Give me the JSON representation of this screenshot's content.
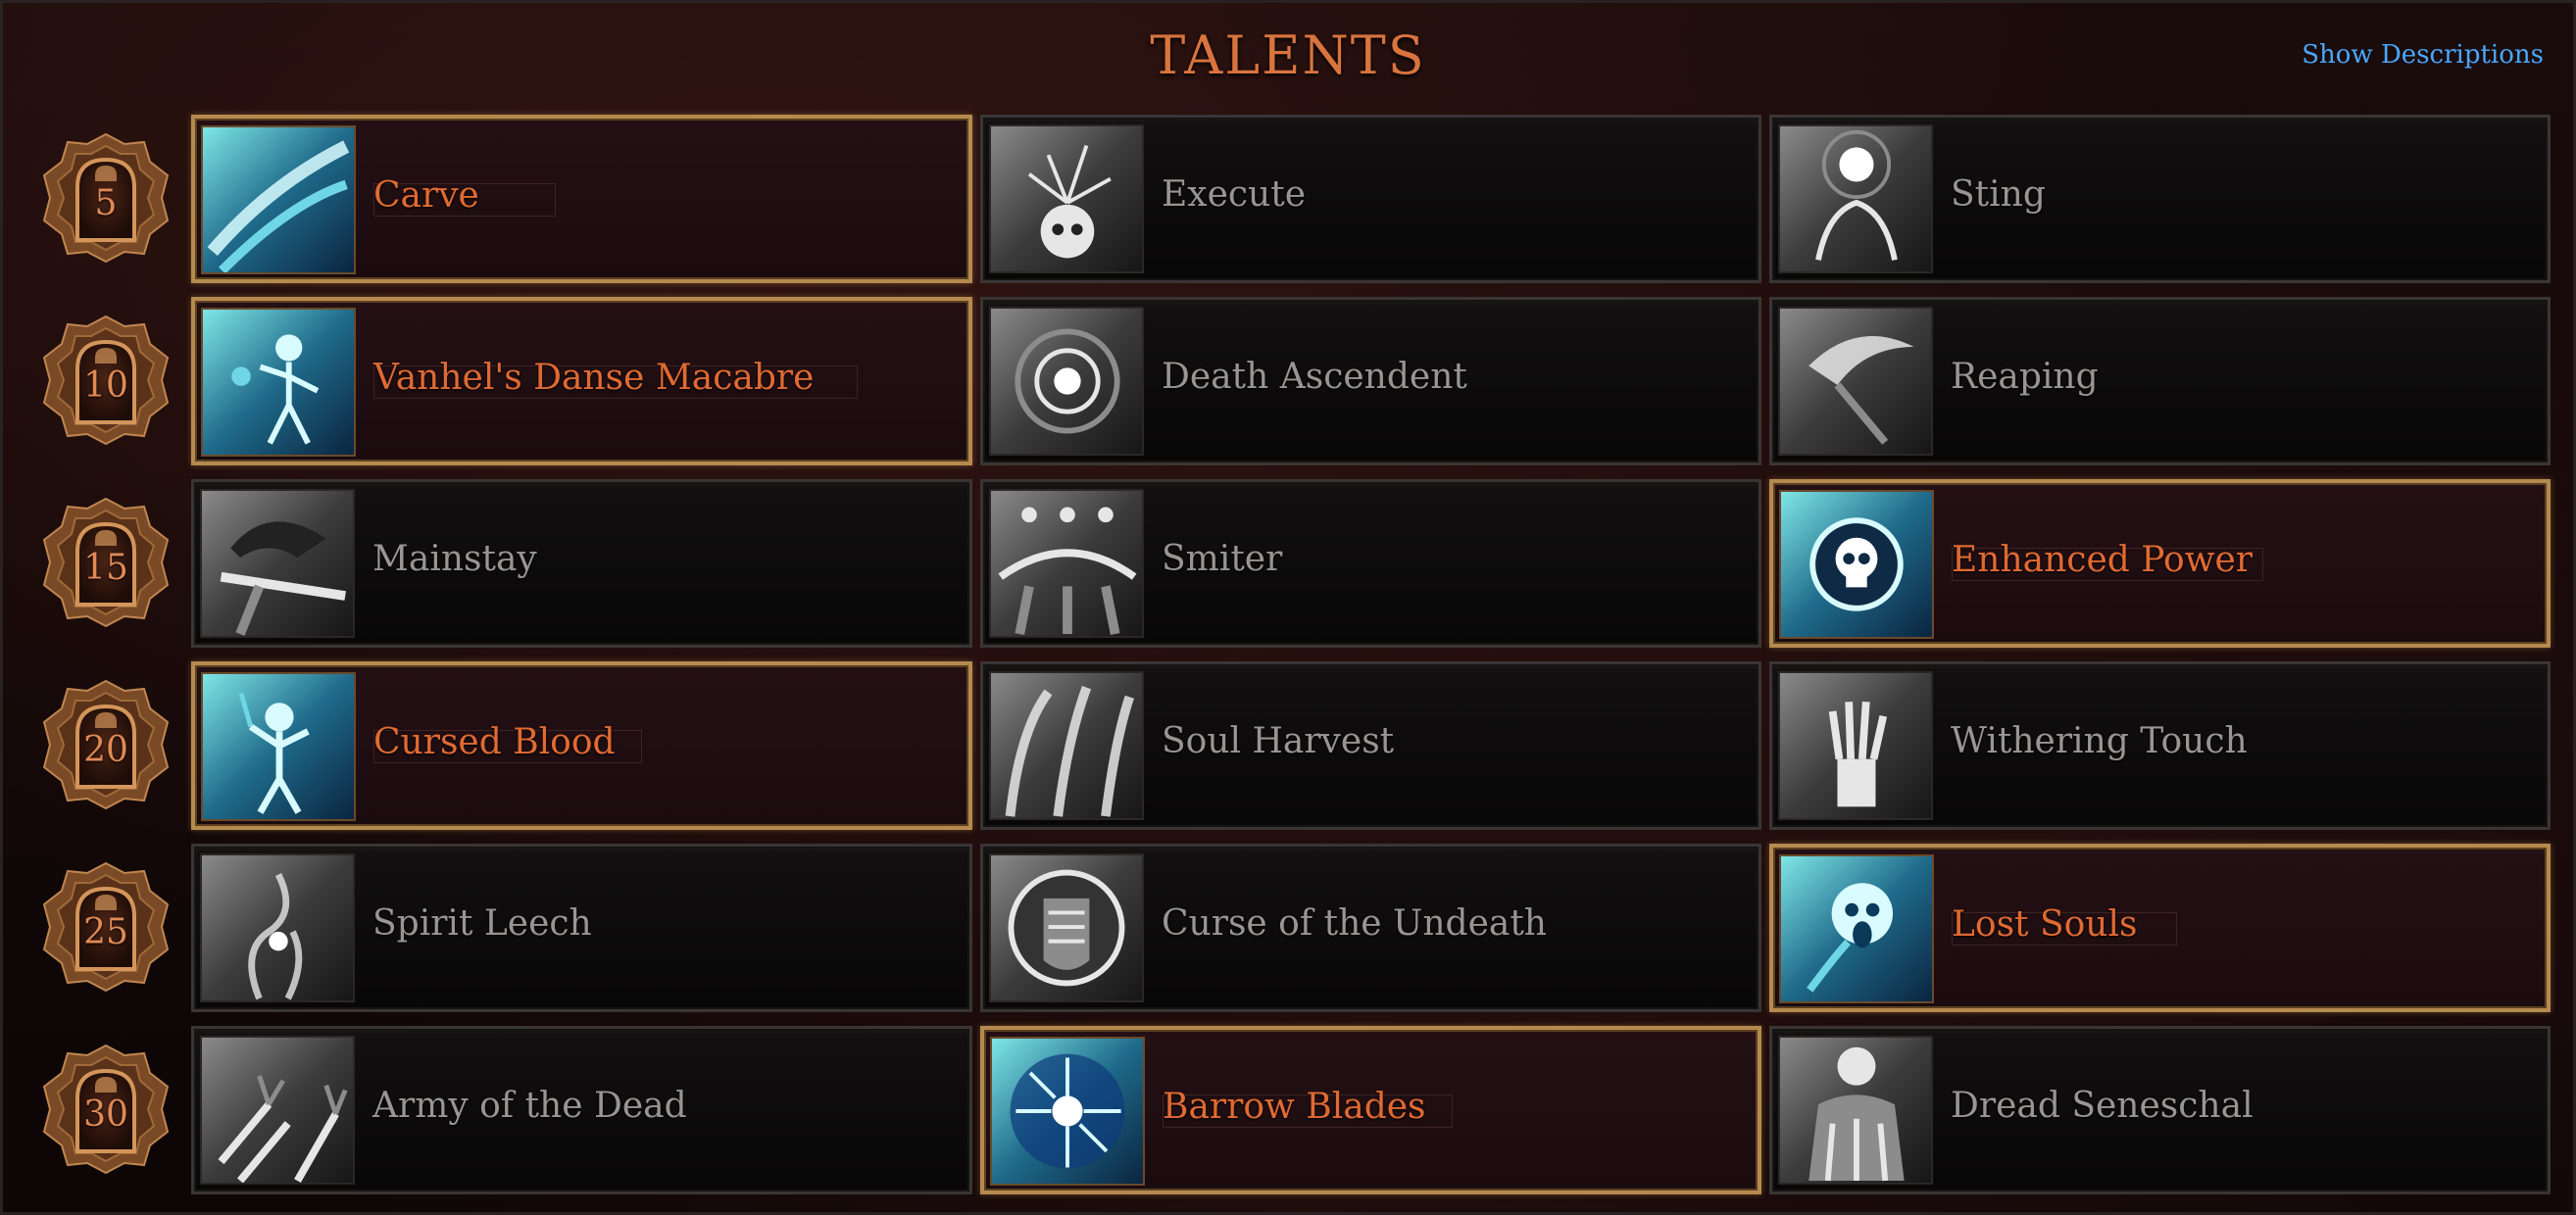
{
  "header": {
    "title": "TALENTS",
    "show_descriptions": "Show Descriptions"
  },
  "accent_colors": {
    "selected_text": "#e06a32",
    "unselected_text": "#9a9494",
    "selected_border": "#b58a4e",
    "link": "#4aa8ff"
  },
  "rows": [
    {
      "level": "5",
      "talents": [
        {
          "name": "Carve",
          "selected": true,
          "icon": "slash-icon"
        },
        {
          "name": "Execute",
          "selected": false,
          "icon": "skull-roots-icon"
        },
        {
          "name": "Sting",
          "selected": false,
          "icon": "hands-orb-icon"
        }
      ]
    },
    {
      "level": "10",
      "talents": [
        {
          "name": "Vanhel's Danse Macabre",
          "selected": true,
          "icon": "dancing-skeleton-icon"
        },
        {
          "name": "Death Ascendent",
          "selected": false,
          "icon": "vortex-icon"
        },
        {
          "name": "Reaping",
          "selected": false,
          "icon": "scythe-icon"
        }
      ]
    },
    {
      "level": "15",
      "talents": [
        {
          "name": "Mainstay",
          "selected": false,
          "icon": "reaper-hood-icon"
        },
        {
          "name": "Smiter",
          "selected": false,
          "icon": "ghost-figures-icon"
        },
        {
          "name": "Enhanced Power",
          "selected": true,
          "icon": "skull-circle-icon"
        }
      ]
    },
    {
      "level": "20",
      "talents": [
        {
          "name": "Cursed Blood",
          "selected": true,
          "icon": "skeleton-summon-icon"
        },
        {
          "name": "Soul Harvest",
          "selected": false,
          "icon": "souls-rising-icon"
        },
        {
          "name": "Withering Touch",
          "selected": false,
          "icon": "bony-hand-icon"
        }
      ]
    },
    {
      "level": "25",
      "talents": [
        {
          "name": "Spirit Leech",
          "selected": false,
          "icon": "spirit-smoke-icon"
        },
        {
          "name": "Curse of the Undeath",
          "selected": false,
          "icon": "ribcage-shield-icon"
        },
        {
          "name": "Lost Souls",
          "selected": true,
          "icon": "wailing-skull-icon"
        }
      ]
    },
    {
      "level": "30",
      "talents": [
        {
          "name": "Army of the Dead",
          "selected": false,
          "icon": "skeleton-hands-icon"
        },
        {
          "name": "Barrow Blades",
          "selected": true,
          "icon": "blade-storm-icon"
        },
        {
          "name": "Dread Seneschal",
          "selected": false,
          "icon": "skull-throne-icon"
        }
      ]
    }
  ]
}
